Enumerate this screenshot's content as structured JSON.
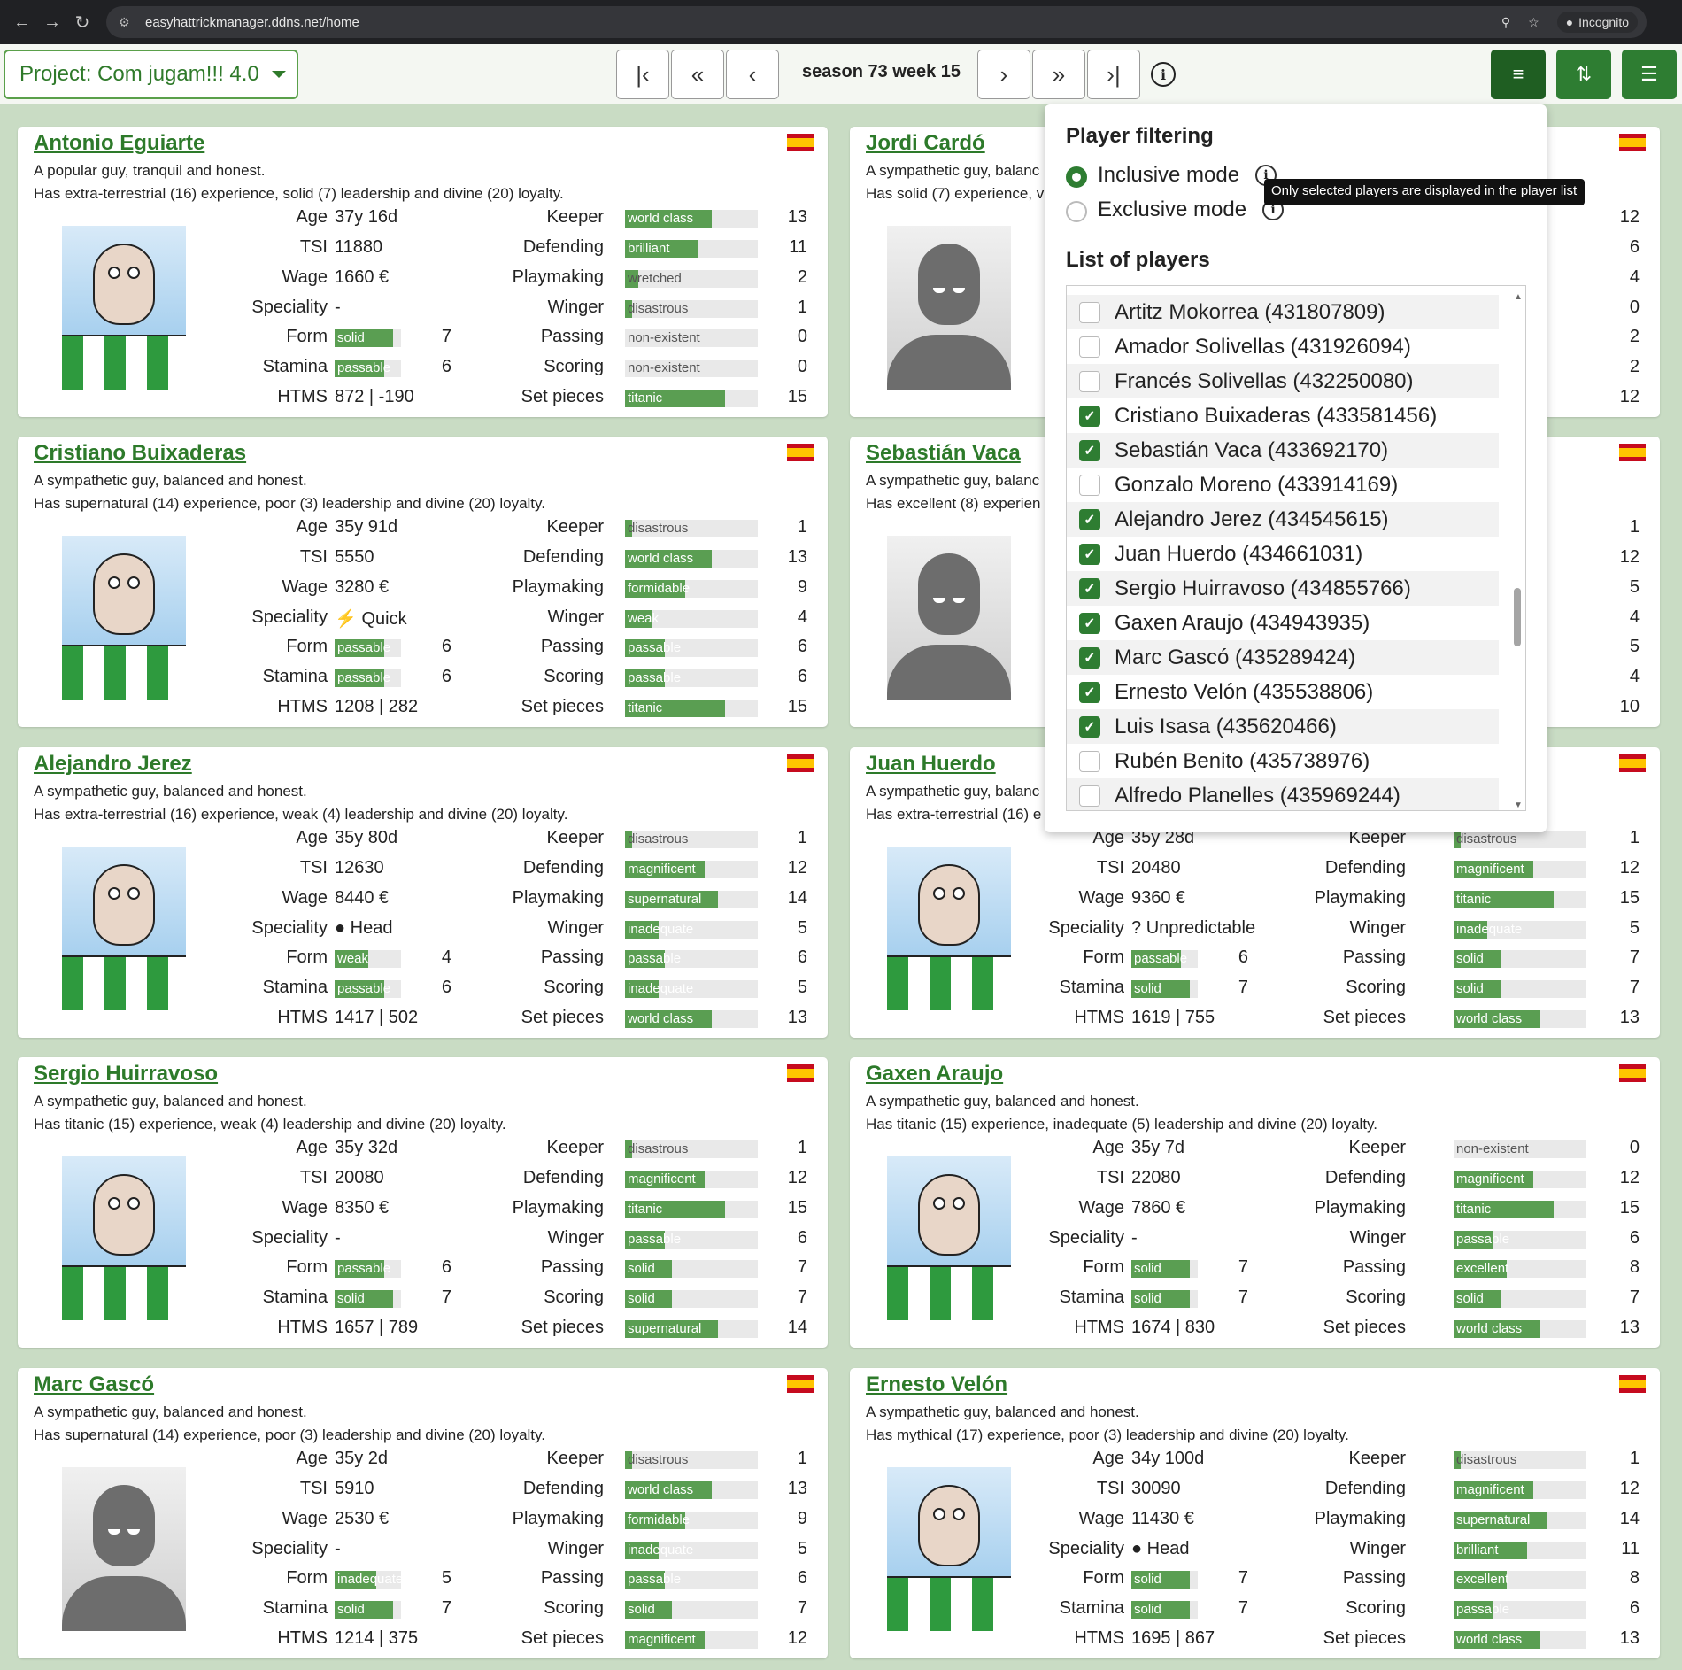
{
  "browser": {
    "url": "easyhattrickmanager.ddns.net/home",
    "incognito_label": "Incognito"
  },
  "header": {
    "project_label": "Project: Com jugam!!! 4.0",
    "season_label": "season 73 week 15"
  },
  "labels": {
    "age": "Age",
    "tsi": "TSI",
    "wage": "Wage",
    "speciality": "Speciality",
    "form": "Form",
    "stamina": "Stamina",
    "htms": "HTMS",
    "keeper": "Keeper",
    "defending": "Defending",
    "playmaking": "Playmaking",
    "winger": "Winger",
    "passing": "Passing",
    "scoring": "Scoring",
    "set_pieces": "Set pieces"
  },
  "popup": {
    "title": "Player filtering",
    "inclusive_label": "Inclusive mode",
    "exclusive_label": "Exclusive mode",
    "tooltip": "Only selected players are displayed in the player list",
    "list_title": "List of players",
    "players": [
      {
        "label": "Artitz Mokorrea (431807809)",
        "checked": false
      },
      {
        "label": "Amador Solivellas (431926094)",
        "checked": false
      },
      {
        "label": "Francés Solivellas (432250080)",
        "checked": false
      },
      {
        "label": "Cristiano Buixaderas (433581456)",
        "checked": true
      },
      {
        "label": "Sebastián Vaca (433692170)",
        "checked": true
      },
      {
        "label": "Gonzalo Moreno (433914169)",
        "checked": false
      },
      {
        "label": "Alejandro Jerez (434545615)",
        "checked": true
      },
      {
        "label": "Juan Huerdo (434661031)",
        "checked": true
      },
      {
        "label": "Sergio Huirravoso (434855766)",
        "checked": true
      },
      {
        "label": "Gaxen Araujo (434943935)",
        "checked": true
      },
      {
        "label": "Marc Gascó (435289424)",
        "checked": true
      },
      {
        "label": "Ernesto Velón (435538806)",
        "checked": true
      },
      {
        "label": "Luis Isasa (435620466)",
        "checked": true
      },
      {
        "label": "Rubén Benito (435738976)",
        "checked": false
      },
      {
        "label": "Alfredo Planelles (435969244)",
        "checked": false
      }
    ]
  },
  "cards": [
    {
      "name": "Antonio Eguiarte",
      "desc1": "A popular guy, tranquil and honest.",
      "desc2": "Has extra-terrestrial (16) experience, solid (7) leadership and divine (20) loyalty.",
      "age": "37y 16d",
      "tsi": "11880",
      "wage": "1660 €",
      "speciality": "-",
      "speciality_icon": "",
      "form": {
        "text": "solid",
        "value": 7
      },
      "stamina": {
        "text": "passable",
        "value": 6
      },
      "htms": "872 | -190",
      "portrait": "face",
      "skills": [
        {
          "text": "world class",
          "value": 13
        },
        {
          "text": "brilliant",
          "value": 11
        },
        {
          "text": "wretched",
          "value": 2
        },
        {
          "text": "disastrous",
          "value": 1
        },
        {
          "text": "non-existent",
          "value": 0
        },
        {
          "text": "non-existent",
          "value": 0
        },
        {
          "text": "titanic",
          "value": 15
        }
      ]
    },
    {
      "name": "Jordi Cardó",
      "desc1": "A sympathetic guy, balanc",
      "desc2": "Has solid (7) experience, v",
      "portrait": "silhouette",
      "skill_values": [
        "12",
        "6",
        "4",
        "0",
        "2",
        "2",
        "12"
      ]
    },
    {
      "name": "Cristiano Buixaderas",
      "desc1": "A sympathetic guy, balanced and honest.",
      "desc2": "Has supernatural (14) experience, poor (3) leadership and divine (20) loyalty.",
      "age": "35y 91d",
      "tsi": "5550",
      "wage": "3280 €",
      "speciality": "Quick",
      "speciality_icon": "quick-icon",
      "form": {
        "text": "passable",
        "value": 6
      },
      "stamina": {
        "text": "passable",
        "value": 6
      },
      "htms": "1208 | 282",
      "portrait": "face",
      "skills": [
        {
          "text": "disastrous",
          "value": 1
        },
        {
          "text": "world class",
          "value": 13
        },
        {
          "text": "formidable",
          "value": 9
        },
        {
          "text": "weak",
          "value": 4
        },
        {
          "text": "passable",
          "value": 6
        },
        {
          "text": "passable",
          "value": 6
        },
        {
          "text": "titanic",
          "value": 15
        }
      ]
    },
    {
      "name": "Sebastián Vaca",
      "desc1": "A sympathetic guy, balanc",
      "desc2": "Has excellent (8) experien",
      "portrait": "silhouette",
      "skill_values": [
        "1",
        "12",
        "5",
        "4",
        "5",
        "4",
        "10"
      ]
    },
    {
      "name": "Alejandro Jerez",
      "desc1": "A sympathetic guy, balanced and honest.",
      "desc2": "Has extra-terrestrial (16) experience, weak (4) leadership and divine (20) loyalty.",
      "age": "35y 80d",
      "tsi": "12630",
      "wage": "8440 €",
      "speciality": "Head",
      "speciality_icon": "head-icon",
      "form": {
        "text": "weak",
        "value": 4
      },
      "stamina": {
        "text": "passable",
        "value": 6
      },
      "htms": "1417 | 502",
      "portrait": "face",
      "skills": [
        {
          "text": "disastrous",
          "value": 1
        },
        {
          "text": "magnificent",
          "value": 12
        },
        {
          "text": "supernatural",
          "value": 14
        },
        {
          "text": "inadequate",
          "value": 5
        },
        {
          "text": "passable",
          "value": 6
        },
        {
          "text": "inadequate",
          "value": 5
        },
        {
          "text": "world class",
          "value": 13
        }
      ]
    },
    {
      "name": "Juan Huerdo",
      "desc1": "A sympathetic guy, balanc",
      "desc2": "Has extra-terrestrial (16) e",
      "age": "35y 28d",
      "tsi": "20480",
      "wage": "9360 €",
      "speciality": "Unpredictable",
      "speciality_icon": "unpredictable-icon",
      "form": {
        "text": "passable",
        "value": 6
      },
      "stamina": {
        "text": "solid",
        "value": 7
      },
      "htms": "1619 | 755",
      "portrait": "face",
      "skills": [
        {
          "text": "disastrous",
          "value": 1
        },
        {
          "text": "magnificent",
          "value": 12
        },
        {
          "text": "titanic",
          "value": 15
        },
        {
          "text": "inadequate",
          "value": 5
        },
        {
          "text": "solid",
          "value": 7
        },
        {
          "text": "solid",
          "value": 7
        },
        {
          "text": "world class",
          "value": 13
        }
      ]
    },
    {
      "name": "Sergio Huirravoso",
      "desc1": "A sympathetic guy, balanced and honest.",
      "desc2": "Has titanic (15) experience, weak (4) leadership and divine (20) loyalty.",
      "age": "35y 32d",
      "tsi": "20080",
      "wage": "8350 €",
      "speciality": "-",
      "speciality_icon": "",
      "form": {
        "text": "passable",
        "value": 6
      },
      "stamina": {
        "text": "solid",
        "value": 7
      },
      "htms": "1657 | 789",
      "portrait": "face",
      "skills": [
        {
          "text": "disastrous",
          "value": 1
        },
        {
          "text": "magnificent",
          "value": 12
        },
        {
          "text": "titanic",
          "value": 15
        },
        {
          "text": "passable",
          "value": 6
        },
        {
          "text": "solid",
          "value": 7
        },
        {
          "text": "solid",
          "value": 7
        },
        {
          "text": "supernatural",
          "value": 14
        }
      ]
    },
    {
      "name": "Gaxen Araujo",
      "desc1": "A sympathetic guy, balanced and honest.",
      "desc2": "Has titanic (15) experience, inadequate (5) leadership and divine (20) loyalty.",
      "age": "35y 7d",
      "tsi": "22080",
      "wage": "7860 €",
      "speciality": "-",
      "speciality_icon": "",
      "form": {
        "text": "solid",
        "value": 7
      },
      "stamina": {
        "text": "solid",
        "value": 7
      },
      "htms": "1674 | 830",
      "portrait": "face",
      "skills": [
        {
          "text": "non-existent",
          "value": 0
        },
        {
          "text": "magnificent",
          "value": 12
        },
        {
          "text": "titanic",
          "value": 15
        },
        {
          "text": "passable",
          "value": 6
        },
        {
          "text": "excellent",
          "value": 8
        },
        {
          "text": "solid",
          "value": 7
        },
        {
          "text": "world class",
          "value": 13
        }
      ]
    },
    {
      "name": "Marc Gascó",
      "desc1": "A sympathetic guy, balanced and honest.",
      "desc2": "Has supernatural (14) experience, poor (3) leadership and divine (20) loyalty.",
      "age": "35y 2d",
      "tsi": "5910",
      "wage": "2530 €",
      "speciality": "-",
      "speciality_icon": "",
      "form": {
        "text": "inadequate",
        "value": 5
      },
      "stamina": {
        "text": "solid",
        "value": 7
      },
      "htms": "1214 | 375",
      "portrait": "silhouette",
      "skills": [
        {
          "text": "disastrous",
          "value": 1
        },
        {
          "text": "world class",
          "value": 13
        },
        {
          "text": "formidable",
          "value": 9
        },
        {
          "text": "inadequate",
          "value": 5
        },
        {
          "text": "passable",
          "value": 6
        },
        {
          "text": "solid",
          "value": 7
        },
        {
          "text": "magnificent",
          "value": 12
        }
      ]
    },
    {
      "name": "Ernesto Velón",
      "desc1": "A sympathetic guy, balanced and honest.",
      "desc2": "Has mythical (17) experience, poor (3) leadership and divine (20) loyalty.",
      "age": "34y 100d",
      "tsi": "30090",
      "wage": "11430 €",
      "speciality": "Head",
      "speciality_icon": "head-icon",
      "form": {
        "text": "solid",
        "value": 7
      },
      "stamina": {
        "text": "solid",
        "value": 7
      },
      "htms": "1695 | 867",
      "portrait": "face",
      "skills": [
        {
          "text": "disastrous",
          "value": 1
        },
        {
          "text": "magnificent",
          "value": 12
        },
        {
          "text": "supernatural",
          "value": 14
        },
        {
          "text": "brilliant",
          "value": 11
        },
        {
          "text": "excellent",
          "value": 8
        },
        {
          "text": "passable",
          "value": 6
        },
        {
          "text": "world class",
          "value": 13
        }
      ]
    }
  ]
}
